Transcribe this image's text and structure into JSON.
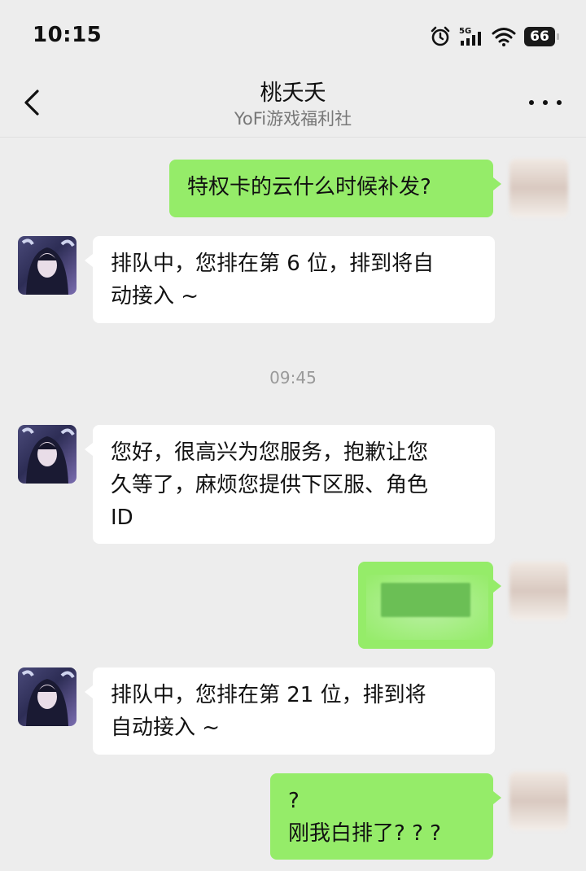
{
  "status_bar": {
    "time": "10:15",
    "network": "5G",
    "battery": "66"
  },
  "header": {
    "title": "桃夭夭",
    "subtitle": "YoFi游戏福利社"
  },
  "messages": [
    {
      "side": "out",
      "lines": [
        "特权卡的云什么时候补发?"
      ]
    },
    {
      "side": "in",
      "lines": [
        "排队中，您排在第 6 位，排到将自",
        "动接入 ~"
      ]
    },
    {
      "side": "in",
      "lines": [
        "您好，很高兴为您服务，抱歉让您",
        "久等了，麻烦您提供下区服、角色",
        "ID"
      ]
    },
    {
      "side": "out",
      "lines": [
        ""
      ],
      "redacted": true
    },
    {
      "side": "in",
      "lines": [
        "排队中，您排在第 21 位，排到将",
        "自动接入 ~"
      ]
    },
    {
      "side": "out",
      "lines": [
        "?",
        "刚我白排了? ? ?"
      ]
    }
  ],
  "timestamp": "09:45",
  "colors": {
    "background": "#ededed",
    "outgoing_bubble": "#95ec69",
    "incoming_bubble": "#ffffff"
  }
}
